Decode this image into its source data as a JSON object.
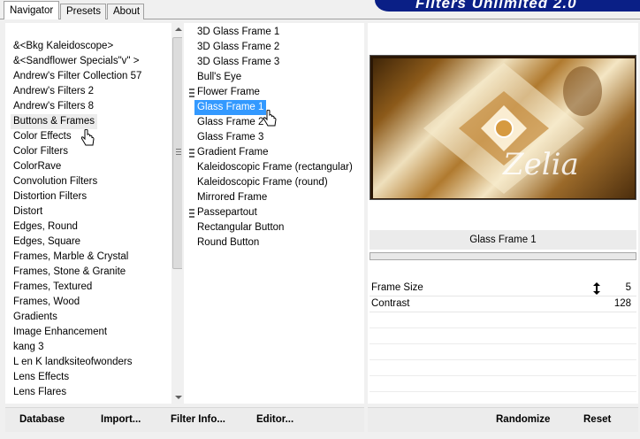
{
  "tabs": [
    {
      "label": "Navigator",
      "active": true
    },
    {
      "label": "Presets",
      "active": false
    },
    {
      "label": "About",
      "active": false
    }
  ],
  "banner": {
    "text": "Filters Unlimited 2.0"
  },
  "categories": [
    "&<Bkg Kaleidoscope>",
    "&<Sandflower Specials\"v\" >",
    "Andrew's Filter Collection 57",
    "Andrew's Filters 2",
    "Andrew's Filters 8",
    "Buttons & Frames",
    "Color Effects",
    "Color Filters",
    "ColorRave",
    "Convolution Filters",
    "Distortion Filters",
    "Distort",
    "Edges, Round",
    "Edges, Square",
    "Frames, Marble & Crystal",
    "Frames, Stone & Granite",
    "Frames, Textured",
    "Frames, Wood",
    "Gradients",
    "Image Enhancement",
    "kang 3",
    "L en K landksiteofwonders",
    "Lens Effects",
    "Lens Flares"
  ],
  "selected_category": "Buttons & Frames",
  "filters": [
    {
      "label": "3D Glass Frame 1",
      "group": false
    },
    {
      "label": "3D Glass Frame 2",
      "group": false
    },
    {
      "label": "3D Glass Frame 3",
      "group": false
    },
    {
      "label": "Bull's Eye",
      "group": false
    },
    {
      "label": "Flower Frame",
      "group": true
    },
    {
      "label": "Glass Frame 1",
      "group": false
    },
    {
      "label": "Glass Frame 2",
      "group": false
    },
    {
      "label": "Glass Frame 3",
      "group": false
    },
    {
      "label": "Gradient Frame",
      "group": true
    },
    {
      "label": "Kaleidoscopic Frame (rectangular)",
      "group": false
    },
    {
      "label": "Kaleidoscopic Frame (round)",
      "group": false
    },
    {
      "label": "Mirrored Frame",
      "group": false
    },
    {
      "label": "Passepartout",
      "group": true
    },
    {
      "label": "Rectangular Button",
      "group": false
    },
    {
      "label": "Round Button",
      "group": false
    }
  ],
  "selected_filter": "Glass Frame 1",
  "preview": {
    "watermark": "Zelia"
  },
  "filter_title": "Glass Frame 1",
  "params": [
    {
      "label": "Frame Size",
      "value": "5"
    },
    {
      "label": "Contrast",
      "value": "128"
    }
  ],
  "buttons": {
    "database": "Database",
    "import": "Import...",
    "filter_info": "Filter Info...",
    "editor": "Editor...",
    "randomize": "Randomize",
    "reset": "Reset"
  },
  "colors": {
    "selection": "#3399ff",
    "banner": "#0a1f86"
  }
}
